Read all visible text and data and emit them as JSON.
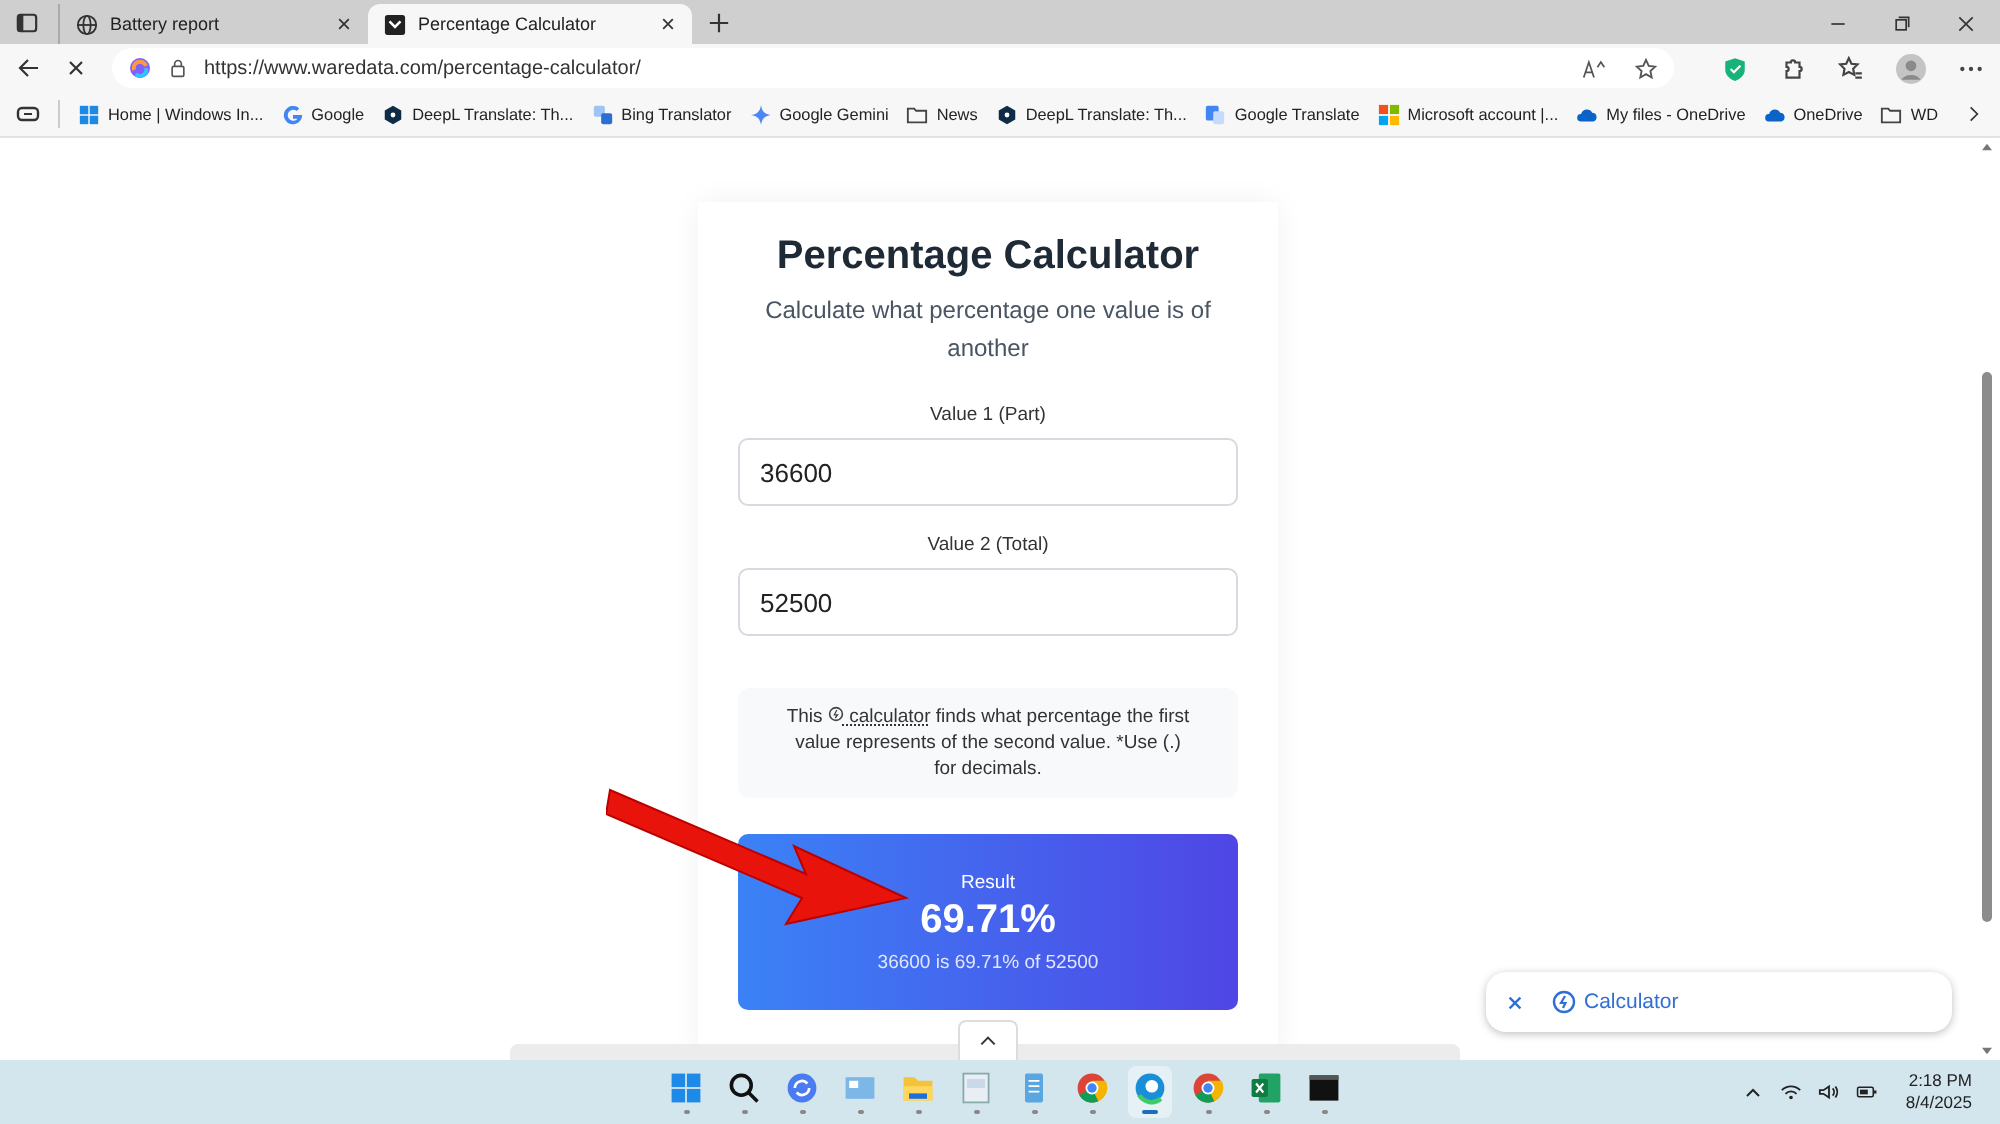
{
  "tabs": [
    {
      "title": "Battery report",
      "kind": "globe",
      "selected": false
    },
    {
      "title": "Percentage Calculator",
      "kind": "site",
      "selected": true
    }
  ],
  "address": {
    "url": "https://www.waredata.com/percentage-calculator/"
  },
  "bookmarks": [
    {
      "label": "Home | Windows In...",
      "kind": "windows"
    },
    {
      "label": "Google",
      "kind": "google"
    },
    {
      "label": "DeepL Translate: Th...",
      "kind": "deepl"
    },
    {
      "label": "Bing Translator",
      "kind": "bing"
    },
    {
      "label": "Google Gemini",
      "kind": "gemini"
    },
    {
      "label": "News",
      "kind": "folder"
    },
    {
      "label": "DeepL Translate: Th...",
      "kind": "deepl"
    },
    {
      "label": "Google Translate",
      "kind": "gtranslate"
    },
    {
      "label": "Microsoft account |...",
      "kind": "microsoft"
    },
    {
      "label": "My files - OneDrive",
      "kind": "onedrive"
    },
    {
      "label": "OneDrive",
      "kind": "onedrive"
    },
    {
      "label": "WD",
      "kind": "folder"
    }
  ],
  "calculator": {
    "title": "Percentage Calculator",
    "subtitle": "Calculate what percentage one value is of another",
    "fields": [
      {
        "label": "Value 1 (Part)",
        "value": "36600"
      },
      {
        "label": "Value 2 (Total)",
        "value": "52500"
      }
    ],
    "info": {
      "before": "This",
      "link": "calculator",
      "after": "finds what percentage the first value represents of the second value. *Use (.) for decimals."
    },
    "result": {
      "label": "Result",
      "value": "69.71%",
      "detail": "36600 is 69.71% of 52500"
    }
  },
  "floating_chip": {
    "label": "Calculator"
  },
  "taskbar": [
    {
      "kind": "start",
      "selected": false
    },
    {
      "kind": "search",
      "selected": false
    },
    {
      "kind": "sync",
      "selected": false
    },
    {
      "kind": "panel",
      "selected": false
    },
    {
      "kind": "folder",
      "selected": false
    },
    {
      "kind": "doc",
      "selected": false
    },
    {
      "kind": "notes",
      "selected": false
    },
    {
      "kind": "chrome",
      "selected": false
    },
    {
      "kind": "edge",
      "selected": true
    },
    {
      "kind": "chrome",
      "selected": false
    },
    {
      "kind": "excel",
      "selected": false
    },
    {
      "kind": "terminal",
      "selected": false
    }
  ],
  "clock": {
    "time": "2:18 PM",
    "date": "8/4/2025"
  }
}
